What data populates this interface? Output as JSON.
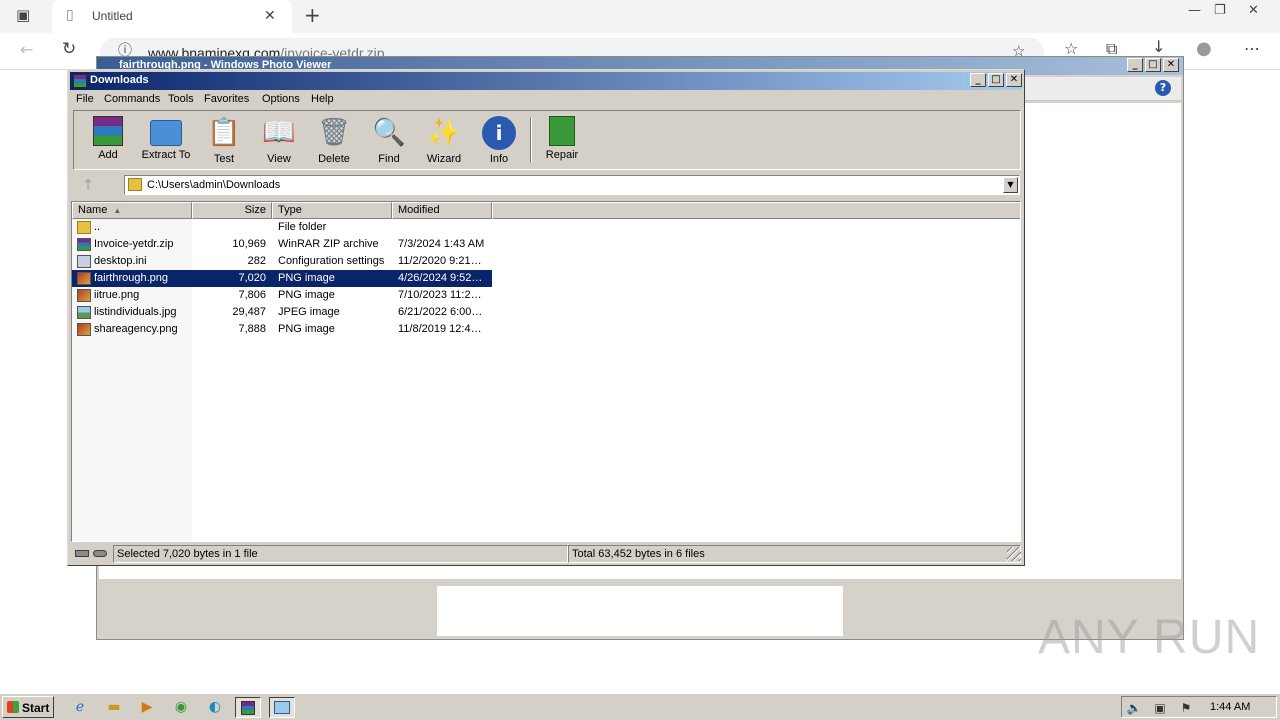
{
  "browser": {
    "tab_title": "Untitled",
    "url_host": "www.bnaminexq.com",
    "url_path": "/invoice-yetdr.zip"
  },
  "photo_viewer": {
    "title": "fairthrough.png - Windows Photo Viewer"
  },
  "winrar": {
    "title": "Downloads",
    "menu": [
      "File",
      "Commands",
      "Tools",
      "Favorites",
      "Options",
      "Help"
    ],
    "toolbar": [
      "Add",
      "Extract To",
      "Test",
      "View",
      "Delete",
      "Find",
      "Wizard",
      "Info",
      "Repair"
    ],
    "path": "C:\\Users\\admin\\Downloads",
    "columns": [
      "Name",
      "Size",
      "Type",
      "Modified"
    ],
    "files": [
      {
        "name": "..",
        "size": "",
        "type": "File folder",
        "modified": "",
        "icon": "folder-up-icon"
      },
      {
        "name": "Invoice-yetdr.zip",
        "size": "10,969",
        "type": "WinRAR ZIP archive",
        "modified": "7/3/2024 1:43 AM",
        "icon": "zip-archive-icon"
      },
      {
        "name": "desktop.ini",
        "size": "282",
        "type": "Configuration settings",
        "modified": "11/2/2020 9:21…",
        "icon": "config-file-icon"
      },
      {
        "name": "fairthrough.png",
        "size": "7,020",
        "type": "PNG image",
        "modified": "4/26/2024 9:52…",
        "icon": "png-image-icon",
        "selected": true
      },
      {
        "name": "iitrue.png",
        "size": "7,806",
        "type": "PNG image",
        "modified": "7/10/2023 11:2…",
        "icon": "png-image-icon"
      },
      {
        "name": "listindividuals.jpg",
        "size": "29,487",
        "type": "JPEG image",
        "modified": "6/21/2022 6:00…",
        "icon": "jpeg-image-icon"
      },
      {
        "name": "shareagency.png",
        "size": "7,888",
        "type": "PNG image",
        "modified": "11/8/2019 12:4…",
        "icon": "png-image-icon"
      }
    ],
    "status_selected": "Selected 7,020 bytes in 1 file",
    "status_total": "Total 63,452 bytes in 6 files"
  },
  "taskbar": {
    "start_label": "Start",
    "clock": "1:44 AM"
  },
  "watermark": "ANY RUN",
  "colors": {
    "selection": "#0a246a",
    "title_gradient_start": "#0a246a",
    "title_gradient_end": "#a6caf0",
    "window_face": "#d4d0c8"
  }
}
